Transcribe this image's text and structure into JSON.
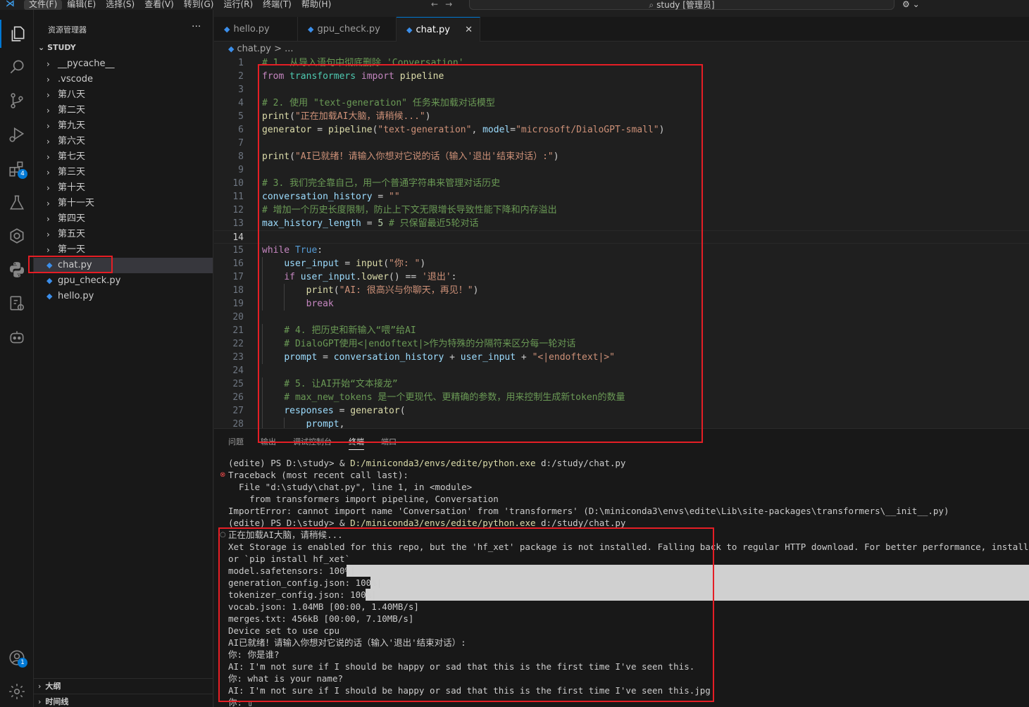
{
  "titlebar": {
    "logo_icon": "vscode-logo-icon",
    "menu": [
      "文件(F)",
      "编辑(E)",
      "选择(S)",
      "查看(V)",
      "转到(G)",
      "运行(R)",
      "终端(T)",
      "帮助(H)"
    ],
    "command_center": "study [管理员]",
    "search_icon": "search-icon",
    "account_label": "⚙"
  },
  "activity_bar": {
    "items": [
      "explorer-icon",
      "search-icon",
      "source-control-icon",
      "run-debug-icon",
      "extensions-icon",
      "testing-icon",
      "remote-icon",
      "python-icon",
      "settings-sync-icon",
      "copilot-icon"
    ],
    "extensions_badge": "4",
    "accounts_badge": "1"
  },
  "sidebar": {
    "title": "资源管理器",
    "more": "···",
    "root": "STUDY",
    "folders": [
      "__pycache__",
      ".vscode",
      "第八天",
      "第二天",
      "第九天",
      "第六天",
      "第七天",
      "第三天",
      "第十天",
      "第十一天",
      "第四天",
      "第五天",
      "第一天"
    ],
    "files": [
      "chat.py",
      "gpu_check.py",
      "hello.py"
    ],
    "outline": "大纲",
    "timeline": "时间线"
  },
  "tabs": [
    {
      "label": "hello.py",
      "active": false
    },
    {
      "label": "gpu_check.py",
      "active": false
    },
    {
      "label": "chat.py",
      "active": true
    }
  ],
  "breadcrumb": {
    "file": "chat.py",
    "rest": " > ..."
  },
  "code": [
    {
      "n": "1",
      "t": "# 1. 从导入语句中彻底删除 'Conversation'",
      "k": "comment"
    },
    {
      "n": "2",
      "t": "from transformers import pipeline",
      "k": "code"
    },
    {
      "n": "3",
      "t": "",
      "k": "code"
    },
    {
      "n": "4",
      "t": "# 2. 使用 \"text-generation\" 任务来加载对话模型",
      "k": "comment"
    },
    {
      "n": "5",
      "t": "print(\"正在加载AI大脑，请稍候...\")",
      "k": "code"
    },
    {
      "n": "6",
      "t": "generator = pipeline(\"text-generation\", model=\"microsoft/DialoGPT-small\")",
      "k": "code"
    },
    {
      "n": "7",
      "t": "",
      "k": "code"
    },
    {
      "n": "8",
      "t": "print(\"AI已就绪！请输入你想对它说的话（输入'退出'结束对话）:\")",
      "k": "code"
    },
    {
      "n": "9",
      "t": "",
      "k": "code"
    },
    {
      "n": "10",
      "t": "# 3. 我们完全靠自己，用一个普通字符串来管理对话历史",
      "k": "comment"
    },
    {
      "n": "11",
      "t": "conversation_history = \"\"",
      "k": "code"
    },
    {
      "n": "12",
      "t": "# 增加一个历史长度限制，防止上下文无限增长导致性能下降和内存溢出",
      "k": "comment"
    },
    {
      "n": "13",
      "t": "max_history_length = 5 # 只保留最近5轮对话",
      "k": "code"
    },
    {
      "n": "14",
      "t": "",
      "k": "code"
    },
    {
      "n": "15",
      "t": "while True:",
      "k": "code"
    },
    {
      "n": "16",
      "t": "    user_input = input(\"你: \")",
      "k": "code"
    },
    {
      "n": "17",
      "t": "    if user_input.lower() == '退出':",
      "k": "code"
    },
    {
      "n": "18",
      "t": "        print(\"AI: 很高兴与你聊天，再见！\")",
      "k": "code"
    },
    {
      "n": "19",
      "t": "        break",
      "k": "code"
    },
    {
      "n": "20",
      "t": "",
      "k": "code"
    },
    {
      "n": "21",
      "t": "    # 4. 把历史和新输入“喂”给AI",
      "k": "comment"
    },
    {
      "n": "22",
      "t": "    # DialoGPT使用<|endoftext|>作为特殊的分隔符来区分每一轮对话",
      "k": "comment"
    },
    {
      "n": "23",
      "t": "    prompt = conversation_history + user_input + \"<|endoftext|>\"",
      "k": "code"
    },
    {
      "n": "24",
      "t": "",
      "k": "code"
    },
    {
      "n": "25",
      "t": "    # 5. 让AI开始“文本接龙”",
      "k": "comment"
    },
    {
      "n": "26",
      "t": "    # max_new_tokens 是一个更现代、更精确的参数，用来控制生成新token的数量",
      "k": "comment"
    },
    {
      "n": "27",
      "t": "    responses = generator(",
      "k": "code"
    },
    {
      "n": "28",
      "t": "        prompt,",
      "k": "code"
    }
  ],
  "current_line": "14",
  "panel": {
    "tabs": [
      "问题",
      "输出",
      "调试控制台",
      "终端",
      "端口"
    ],
    "active_tab": "终端",
    "terminal": [
      {
        "t": "(edite) PS D:\\study> & D:/miniconda3/envs/edite/python.exe d:/study/chat.py",
        "d": ""
      },
      {
        "t": "Traceback (most recent call last):",
        "d": "err"
      },
      {
        "t": "  File \"d:\\study\\chat.py\", line 1, in <module>",
        "d": ""
      },
      {
        "t": "    from transformers import pipeline, Conversation",
        "d": ""
      },
      {
        "t": "ImportError: cannot import name 'Conversation' from 'transformers' (D:\\miniconda3\\envs\\edite\\Lib\\site-packages\\transformers\\__init__.py)",
        "d": ""
      },
      {
        "t": "(edite) PS D:\\study> & D:/miniconda3/envs/edite/python.exe d:/study/chat.py",
        "d": ""
      },
      {
        "t": "正在加载AI大脑，请稍候...",
        "d": "ok"
      },
      {
        "t": "Xet Storage is enabled for this repo, but the 'hf_xet' package is not installed. Falling back to regular HTTP download. For better performance, install the package",
        "d": ""
      },
      {
        "t": "or `pip install hf_xet`",
        "d": ""
      },
      {
        "t": "model.safetensors: 100%|",
        "d": ""
      },
      {
        "t": "generation_config.json: 100%|",
        "d": ""
      },
      {
        "t": "tokenizer_config.json: 100%|",
        "d": ""
      },
      {
        "t": "vocab.json: 1.04MB [00:00, 1.40MB/s]",
        "d": ""
      },
      {
        "t": "merges.txt: 456kB [00:00, 7.10MB/s]",
        "d": ""
      },
      {
        "t": "Device set to use cpu",
        "d": ""
      },
      {
        "t": "AI已就绪！请输入你想对它说的话（输入'退出'结束对话）:",
        "d": ""
      },
      {
        "t": "你: 你是谁?",
        "d": ""
      },
      {
        "t": "AI: I'm not sure if I should be happy or sad that this is the first time I've seen this.",
        "d": ""
      },
      {
        "t": "你: what is your name?",
        "d": ""
      },
      {
        "t": "AI: I'm not sure if I should be happy or sad that this is the first time I've seen this.jpg",
        "d": ""
      },
      {
        "t": "你: ▯",
        "d": ""
      }
    ]
  },
  "colors": {
    "accent": "#0078d4",
    "annotation": "#e51e25",
    "keyword": "#c586c0",
    "string": "#ce9178",
    "variable": "#9cdcfe",
    "function": "#dcdcaa",
    "class": "#4ec9b0",
    "constant": "#569cd6",
    "number": "#b5cea8",
    "comment": "#6a9955"
  }
}
